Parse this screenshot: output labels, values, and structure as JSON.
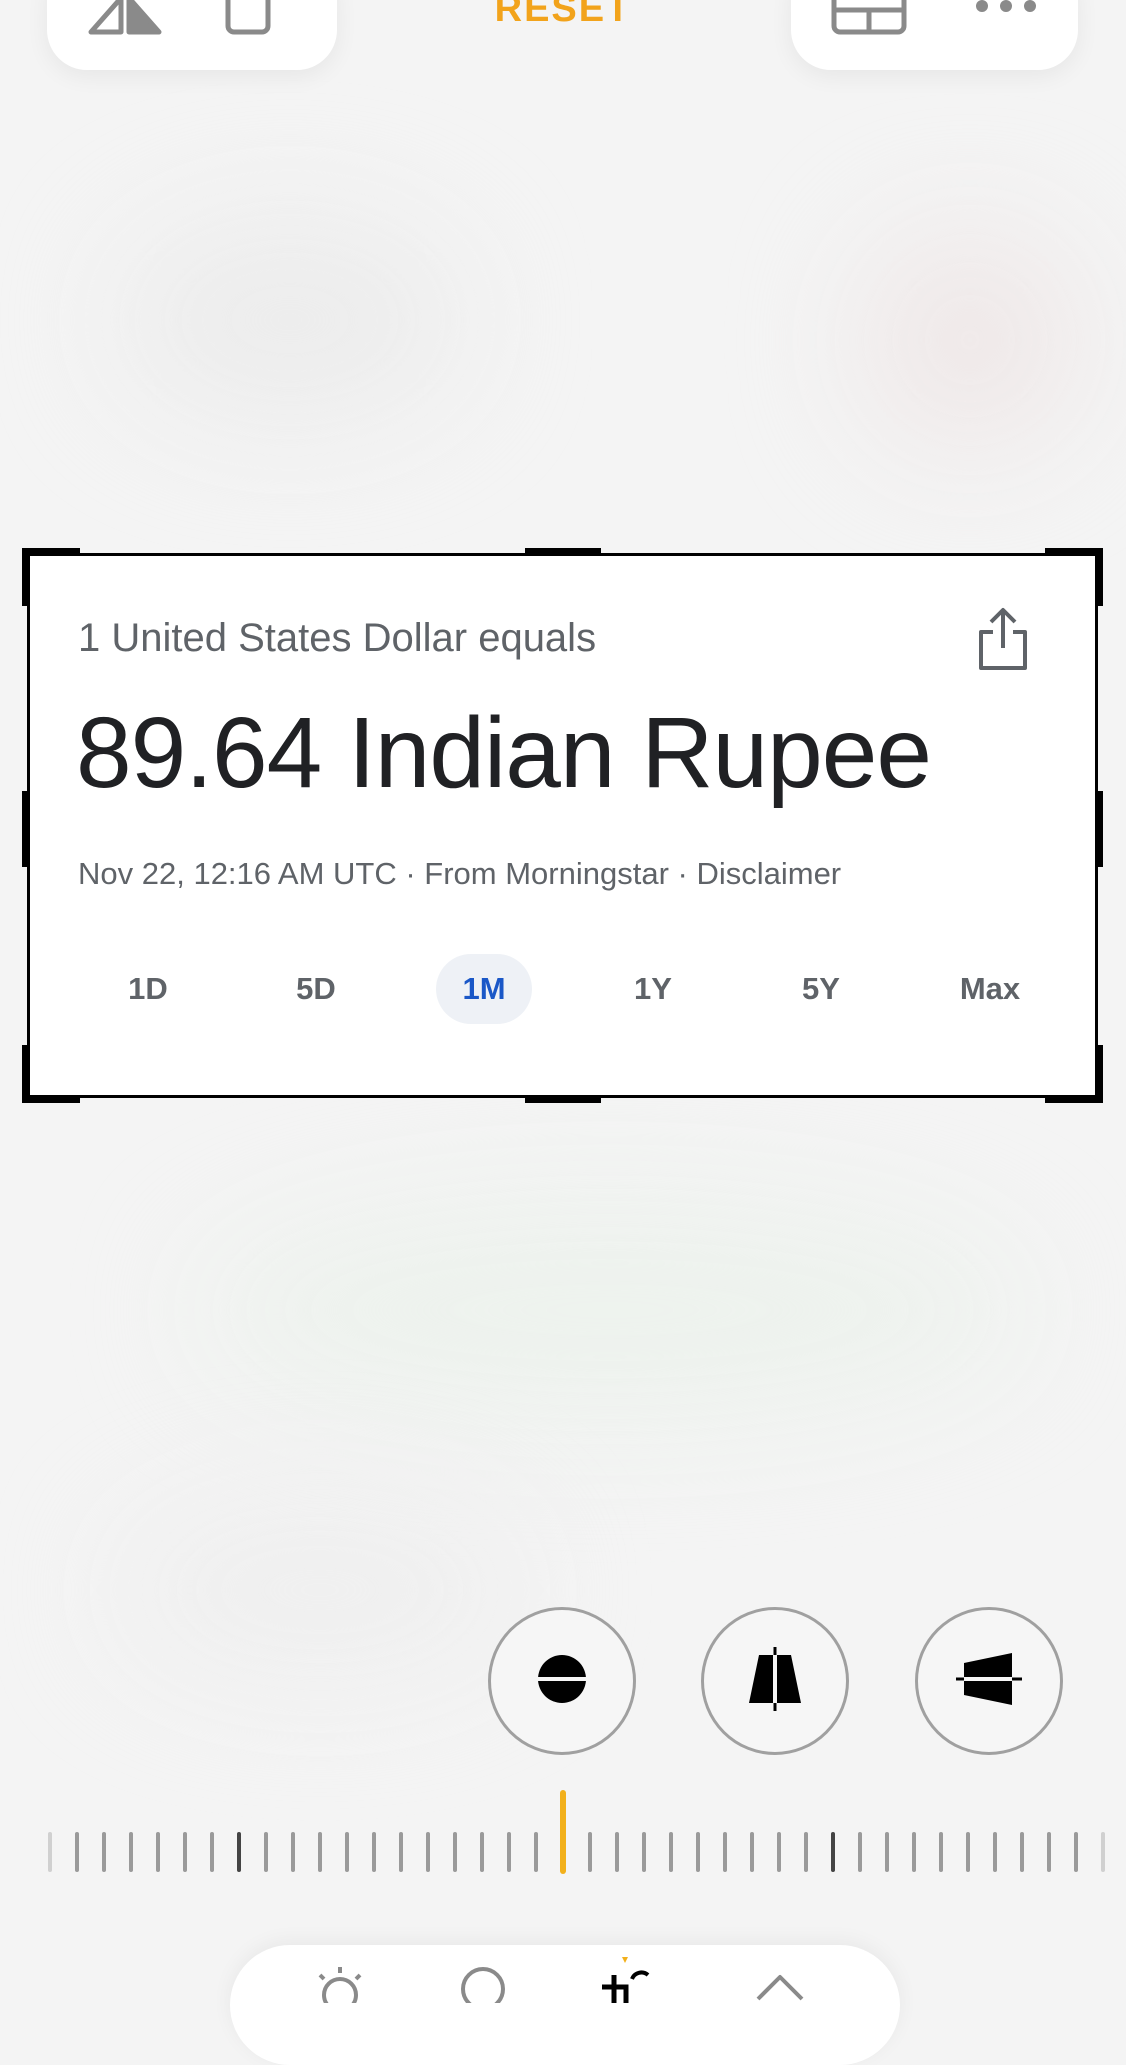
{
  "toolbar": {
    "reset_label": "RESET",
    "accent_color": "#f2a31b",
    "left_icons": [
      "flip-horizontal-icon",
      "rotate-icon"
    ],
    "right_icons": [
      "aspect-ratio-icon",
      "more-icon"
    ]
  },
  "card": {
    "subtitle": "1 United States Dollar equals",
    "value": "89.64 Indian Rupee",
    "meta": "Nov 22, 12:16 AM UTC · From Morningstar · Disclaimer",
    "share_icon": "share-icon",
    "ranges": [
      {
        "label": "1D",
        "active": false
      },
      {
        "label": "5D",
        "active": false
      },
      {
        "label": "1M",
        "active": true
      },
      {
        "label": "1Y",
        "active": false
      },
      {
        "label": "5Y",
        "active": false
      },
      {
        "label": "Max",
        "active": false
      }
    ]
  },
  "perspective_buttons": [
    "straighten-icon",
    "vertical-perspective-icon",
    "horizontal-perspective-icon"
  ],
  "dial": {
    "needle_color": "#f2b01b"
  },
  "bottom_bar": {
    "icons": [
      "auto-adjust-icon",
      "filters-icon",
      "crop-rotate-icon",
      "adjust-icon"
    ],
    "active_index": 2
  }
}
